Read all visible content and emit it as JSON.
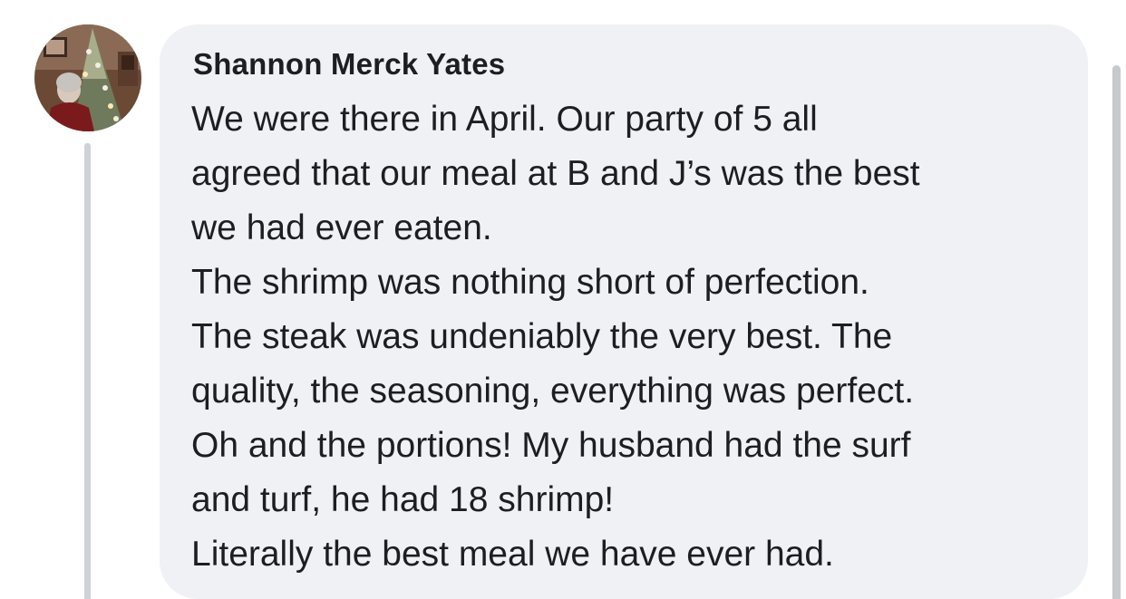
{
  "comment": {
    "author": "Shannon Merck Yates",
    "lines": [
      "We were there in April. Our party of 5 all",
      "agreed that our meal at B and J’s was the best",
      "we had ever eaten.",
      "The shrimp was nothing short of perfection.",
      "The steak was undeniably the very best. The",
      "quality, the seasoning, everything was perfect.",
      "Oh and the portions! My husband had the surf",
      "and turf, he had 18 shrimp!",
      "Literally the best meal we have ever had."
    ]
  },
  "colors": {
    "bubble_background": "#f0f1f4",
    "text": "#1c1e21",
    "thread_line": "#cfd2d7"
  }
}
